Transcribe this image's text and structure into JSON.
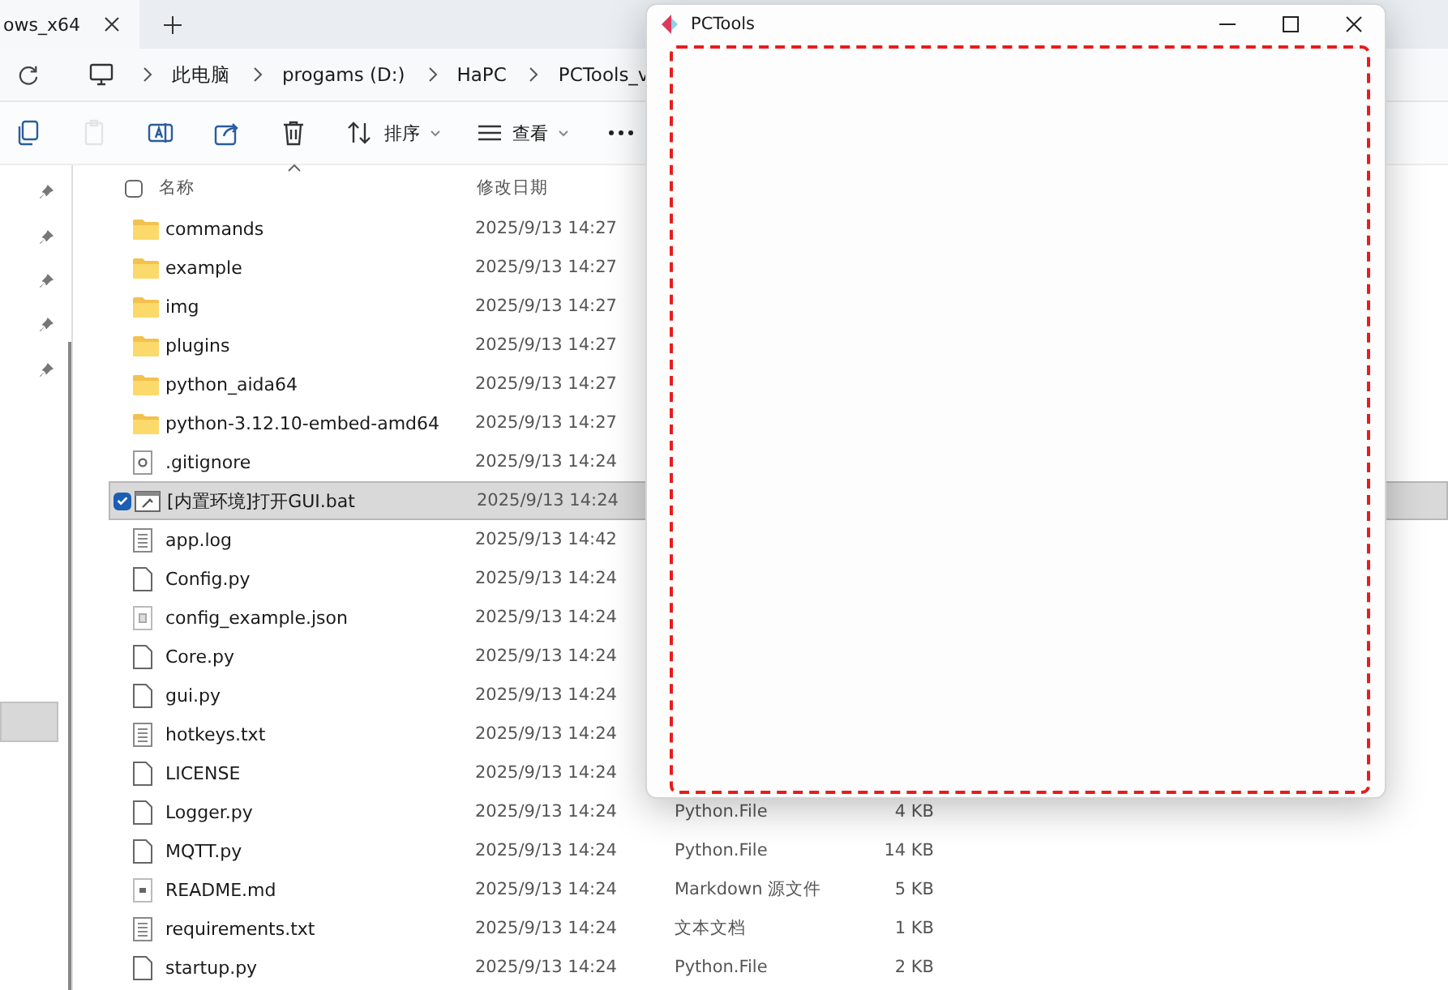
{
  "tabs": [
    {
      "label": "ows_x64",
      "selected": true
    }
  ],
  "address": {
    "crumbs": [
      "此电脑",
      "progams (D:)",
      "HaPC",
      "PCTools_v"
    ]
  },
  "toolbar": {
    "buttons": [
      {
        "kind": "copy",
        "disabled": false
      },
      {
        "kind": "paste",
        "disabled": true
      },
      {
        "kind": "rename",
        "disabled": false
      },
      {
        "kind": "share",
        "disabled": false
      },
      {
        "kind": "delete",
        "disabled": false
      }
    ],
    "sort": "排序",
    "view": "查看"
  },
  "columns": {
    "name": "名称",
    "date": "修改日期",
    "all_checked": false
  },
  "files": [
    {
      "name": "commands",
      "date": "2025/9/13 14:27",
      "kind": "folder",
      "selected": false
    },
    {
      "name": "example",
      "date": "2025/9/13 14:27",
      "kind": "folder",
      "selected": false
    },
    {
      "name": "img",
      "date": "2025/9/13 14:27",
      "kind": "folder",
      "selected": false
    },
    {
      "name": "plugins",
      "date": "2025/9/13 14:27",
      "kind": "folder",
      "selected": false
    },
    {
      "name": "python_aida64",
      "date": "2025/9/13 14:27",
      "kind": "folder",
      "selected": false
    },
    {
      "name": "python-3.12.10-embed-amd64",
      "date": "2025/9/13 14:27",
      "kind": "folder",
      "selected": false
    },
    {
      "name": ".gitignore",
      "date": "2025/9/13 14:24",
      "kind": "config",
      "selected": false
    },
    {
      "name": "[内置环境]打开GUI.bat",
      "date": "2025/9/13 14:24",
      "kind": "script",
      "selected": true
    },
    {
      "name": "app.log",
      "date": "2025/9/13 14:42",
      "kind": "text",
      "selected": false
    },
    {
      "name": "Config.py",
      "date": "2025/9/13 14:24",
      "kind": "file",
      "selected": false
    },
    {
      "name": "config_example.json",
      "date": "2025/9/13 14:24",
      "kind": "data",
      "selected": false
    },
    {
      "name": "Core.py",
      "date": "2025/9/13 14:24",
      "kind": "file",
      "selected": false
    },
    {
      "name": "gui.py",
      "date": "2025/9/13 14:24",
      "kind": "file",
      "selected": false
    },
    {
      "name": "hotkeys.txt",
      "date": "2025/9/13 14:24",
      "kind": "text",
      "selected": false
    },
    {
      "name": "LICENSE",
      "date": "2025/9/13 14:24",
      "kind": "file",
      "selected": false
    },
    {
      "name": "Logger.py",
      "date": "2025/9/13 14:24",
      "kind": "file",
      "selected": false,
      "type": "Python.File",
      "size": "4 KB"
    },
    {
      "name": "MQTT.py",
      "date": "2025/9/13 14:24",
      "kind": "file",
      "selected": false,
      "type": "Python.File",
      "size": "14 KB"
    },
    {
      "name": "README.md",
      "date": "2025/9/13 14:24",
      "kind": "doc",
      "selected": false,
      "type": "Markdown 源文件",
      "size": "5 KB"
    },
    {
      "name": "requirements.txt",
      "date": "2025/9/13 14:24",
      "kind": "text",
      "selected": false,
      "type": "文本文档",
      "size": "1 KB"
    },
    {
      "name": "startup.py",
      "date": "2025/9/13 14:24",
      "kind": "file",
      "selected": false,
      "type": "Python.File",
      "size": "2 KB"
    }
  ],
  "window": {
    "title": "PCTools"
  }
}
